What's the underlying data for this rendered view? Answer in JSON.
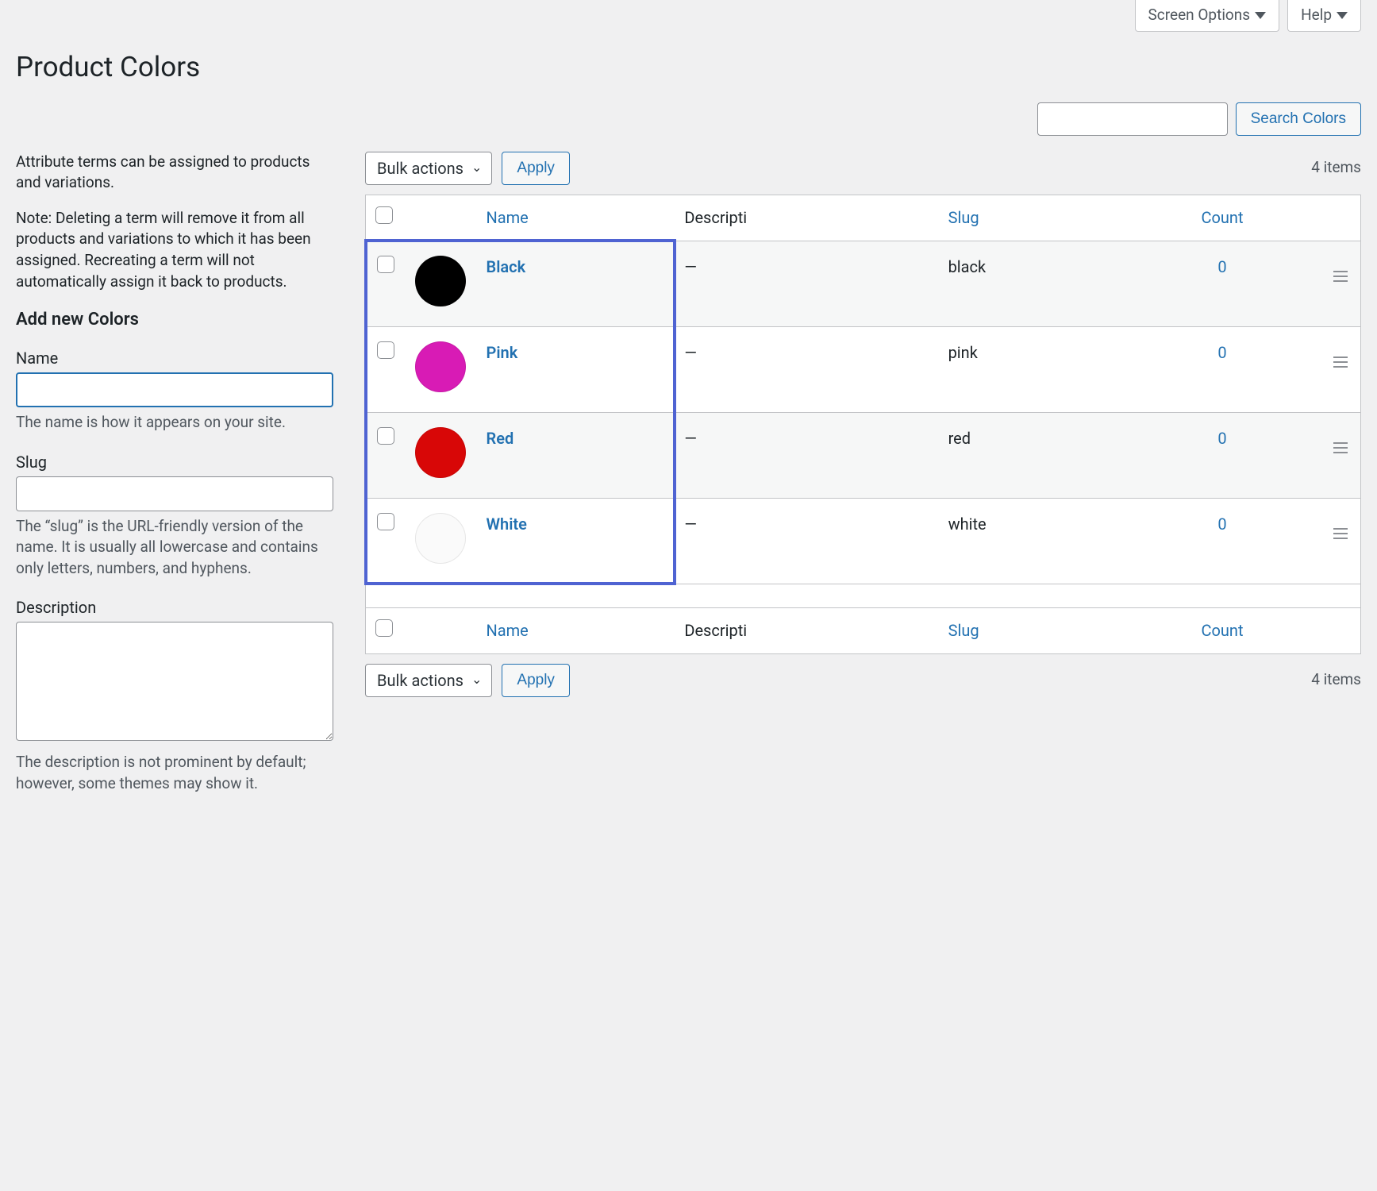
{
  "topTabs": {
    "screenOptions": "Screen Options",
    "help": "Help"
  },
  "pageTitle": "Product Colors",
  "search": {
    "value": "",
    "button": "Search Colors"
  },
  "intro": {
    "para1": "Attribute terms can be assigned to products and variations.",
    "para2": "Note: Deleting a term will remove it from all products and variations to which it has been assigned. Recreating a term will not automatically assign it back to products."
  },
  "form": {
    "heading": "Add new Colors",
    "name": {
      "label": "Name",
      "value": "",
      "help": "The name is how it appears on your site."
    },
    "slug": {
      "label": "Slug",
      "value": "",
      "help": "The “slug” is the URL-friendly version of the name. It is usually all lowercase and contains only letters, numbers, and hyphens."
    },
    "description": {
      "label": "Description",
      "value": "",
      "help": "The description is not prominent by default; however, some themes may show it."
    }
  },
  "bulk": {
    "selectLabel": "Bulk actions",
    "applyLabel": "Apply"
  },
  "itemsCount": "4 items",
  "columns": {
    "name": "Name",
    "description": "Descripti",
    "slug": "Slug",
    "count": "Count"
  },
  "rows": [
    {
      "name": "Black",
      "desc": "—",
      "slug": "black",
      "count": "0",
      "swatch": "#000000"
    },
    {
      "name": "Pink",
      "desc": "—",
      "slug": "pink",
      "count": "0",
      "swatch": "#d81bb5"
    },
    {
      "name": "Red",
      "desc": "—",
      "slug": "red",
      "count": "0",
      "swatch": "#d80707"
    },
    {
      "name": "White",
      "desc": "—",
      "slug": "white",
      "count": "0",
      "swatch": "#fafafa"
    }
  ]
}
